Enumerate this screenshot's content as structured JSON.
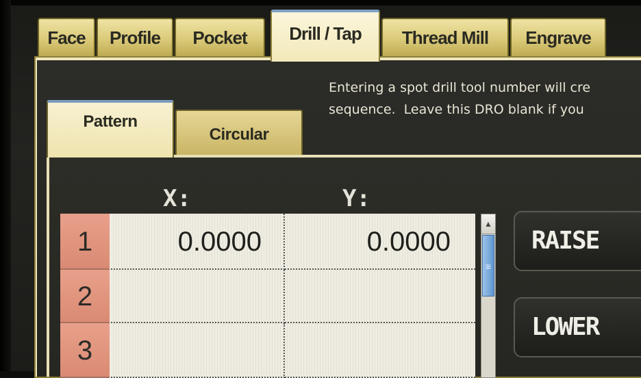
{
  "main_tabs": [
    {
      "label": "Face"
    },
    {
      "label": "Profile"
    },
    {
      "label": "Pocket"
    },
    {
      "label": "Drill / Tap"
    },
    {
      "label": "Thread Mill"
    },
    {
      "label": "Engrave"
    }
  ],
  "active_main_tab": "Drill / Tap",
  "hint": {
    "line1": "Entering a spot drill tool number will cre",
    "line2": "sequence.  Leave this DRO blank if you"
  },
  "sub_tabs": [
    {
      "label": "Pattern"
    },
    {
      "label": "Circular"
    }
  ],
  "active_sub_tab": "Pattern",
  "columns": {
    "x": "X:",
    "y": "Y:"
  },
  "rows": [
    {
      "num": "1",
      "x": "0.0000",
      "y": "0.0000"
    },
    {
      "num": "2",
      "x": "",
      "y": ""
    },
    {
      "num": "3",
      "x": "",
      "y": ""
    }
  ],
  "buttons": {
    "raise": "RAISE",
    "lower": "LOWER"
  },
  "scrollbar": {
    "up_glyph": "▲",
    "thumb_glyph": "≡"
  }
}
